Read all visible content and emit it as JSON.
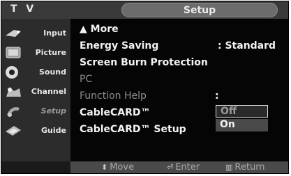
{
  "header": {
    "tv_label": "T V",
    "title": "Setup"
  },
  "sidebar": {
    "items": [
      {
        "label": "Input",
        "icon": "input-icon"
      },
      {
        "label": "Picture",
        "icon": "picture-icon"
      },
      {
        "label": "Sound",
        "icon": "sound-icon"
      },
      {
        "label": "Channel",
        "icon": "channel-icon"
      },
      {
        "label": "Setup",
        "icon": "setup-icon"
      },
      {
        "label": "Guide",
        "icon": "guide-icon"
      }
    ],
    "active": "Setup"
  },
  "menu": {
    "items": [
      {
        "label": "▲ More"
      },
      {
        "label": "Energy Saving",
        "value": ": Standard"
      },
      {
        "label": "Screen Burn Protection"
      },
      {
        "label": "PC"
      },
      {
        "label": "Function Help",
        "value": ":"
      },
      {
        "label": "CableCARD™"
      },
      {
        "label": "CableCARD™ Setup"
      }
    ]
  },
  "dropdown": {
    "options": [
      "Off",
      "On"
    ],
    "highlighted": "On"
  },
  "footer": {
    "move": "Move",
    "enter": "Enter",
    "return": "Return"
  }
}
